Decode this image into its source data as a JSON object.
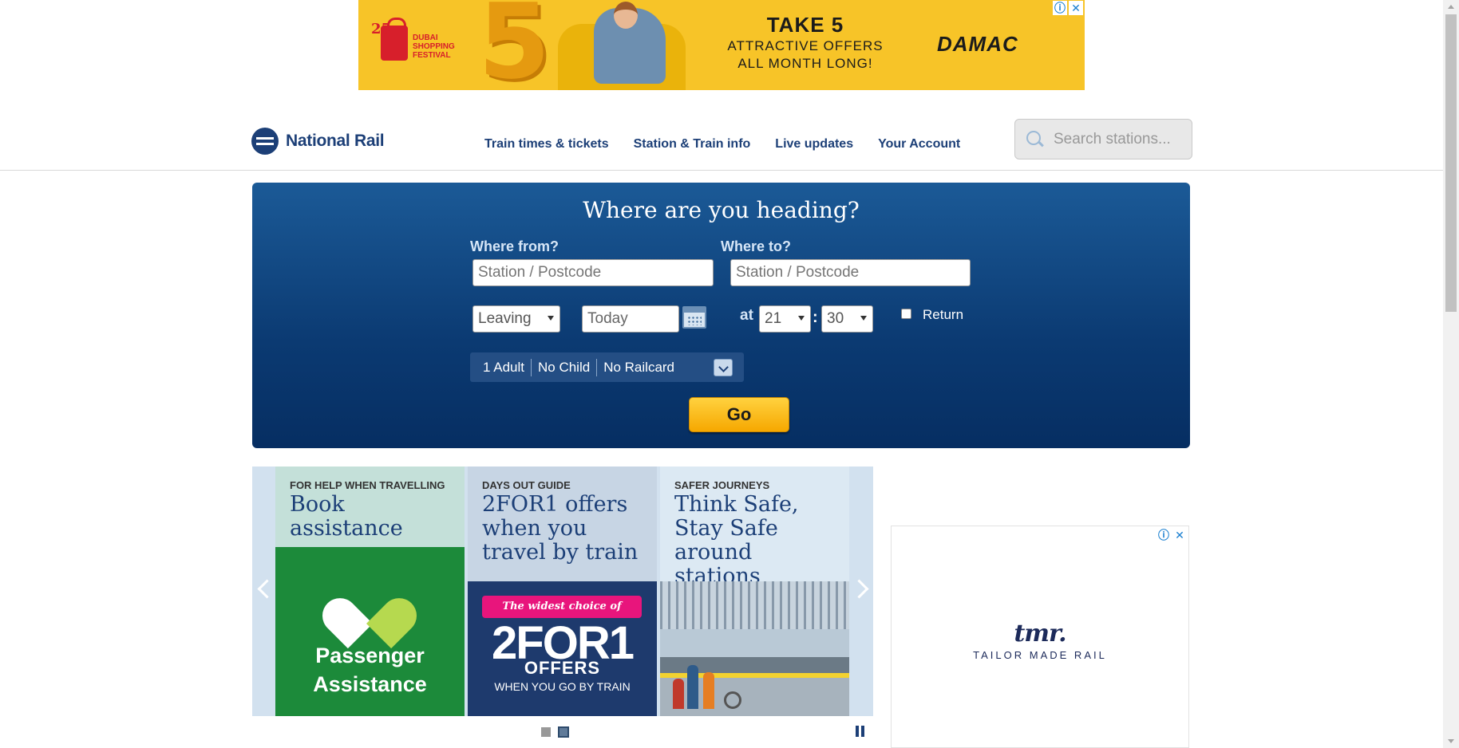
{
  "ad_top": {
    "festival_number": "25",
    "festival_name": "DUBAI SHOPPING FESTIVAL",
    "big_digit": "5",
    "headline": "TAKE 5",
    "subline_1": "ATTRACTIVE OFFERS",
    "subline_2": "ALL MONTH LONG!",
    "brand": "DAMAC",
    "info_icon": "ⓘ",
    "close_icon": "✕",
    "bg_color": "#f7c428"
  },
  "header": {
    "logo_text": "National Rail",
    "nav": [
      "Train times & tickets",
      "Station & Train info",
      "Live updates",
      "Your Account"
    ],
    "search_placeholder": "Search stations..."
  },
  "journey": {
    "heading": "Where are you heading?",
    "from_label": "Where from?",
    "to_label": "Where to?",
    "from_placeholder": "Station / Postcode",
    "to_placeholder": "Station / Postcode",
    "leaving": "Leaving",
    "date": "Today",
    "at_label": "at",
    "hour": "21",
    "colon": ":",
    "minute": "30",
    "return_label": "Return",
    "passengers": [
      "1 Adult",
      "No Child",
      "No Railcard"
    ],
    "go_label": "Go"
  },
  "carousel": {
    "cards": [
      {
        "kicker": "FOR HELP WHEN TRAVELLING",
        "title": "Book assistance",
        "image_text_1": "Passenger",
        "image_text_2": "Assistance"
      },
      {
        "kicker": "DAYS OUT GUIDE",
        "title": "2FOR1 offers when you travel by train",
        "ribbon": "The widest choice of",
        "big": "2FOR1",
        "offers": "OFFERS",
        "sub": "WHEN YOU GO BY TRAIN"
      },
      {
        "kicker": "SAFER JOURNEYS",
        "title": "Think Safe, Stay Safe around stations"
      }
    ],
    "active_dot": 2
  },
  "ad_side": {
    "brand": "tmr.",
    "tagline": "TAILOR MADE RAIL",
    "info_icon": "ⓘ",
    "close_icon": "✕"
  }
}
